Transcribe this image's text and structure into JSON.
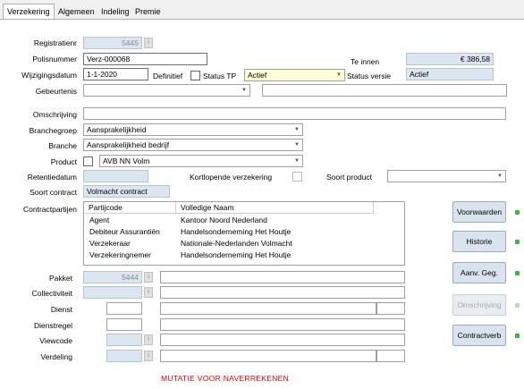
{
  "tabs": [
    "Verzekering",
    "Algemeen",
    "Indeling",
    "Premie"
  ],
  "labels": {
    "registratienr": "Registratienr",
    "polisnummer": "Polisnummer",
    "wijzigingsdatum": "Wijzigingsdatum",
    "definitief": "Definitief",
    "status_tp": "Status TP",
    "status_versie": "Status versie",
    "te_innen": "Te innen",
    "gebeurtenis": "Gebeurtenis",
    "omschrijving": "Omschrijving",
    "branchegroep": "Branchegroep",
    "branche": "Branche",
    "product": "Product",
    "retentiedatum": "Retentiedatum",
    "kortlopende": "Kortlopende verzekering",
    "soort_product": "Soort product",
    "soort_contract": "Soort contract",
    "contractpartijen": "Contractpartijen",
    "pakket": "Pakket",
    "collectiviteit": "Collectiviteit",
    "dienst": "Dienst",
    "dienstregel": "Dienstregel",
    "viewcode": "Viewcode",
    "verdeling": "Verdeling"
  },
  "values": {
    "registratienr": "5445",
    "polisnummer": "Verz-000068",
    "wijzigingsdatum": "1-1-2020",
    "status_tp": "Actief",
    "status_versie": "Actief",
    "te_innen": "€ 386,58",
    "branchegroep": "Aansprakelijkheid",
    "branche": "Aansprakelijkheid bedrijf",
    "product": "AVB NN Volm",
    "soort_contract": "Volmacht contract",
    "pakket": "5444"
  },
  "grid": {
    "headers": [
      "Partijcode",
      "Volledige Naam"
    ],
    "rows": [
      [
        "Agent",
        "Kantoor Noord Nederland"
      ],
      [
        "Debiteur Assurantiën",
        "Handelsonderneming Het Houtje"
      ],
      [
        "Verzekeraar",
        "Nationale-Nederlanden Volmacht"
      ],
      [
        "Verzekeringnemer",
        "Handelsonderneming Het Houtje"
      ]
    ]
  },
  "buttons": {
    "voorwaarden": "Voorwaarden",
    "historie": "Historie",
    "aanv_geg": "Aanv. Geg.",
    "omschrijving": "Omschrijving",
    "contractverb": "Contractverb"
  },
  "info_icon": "i",
  "status_message": "MUTATIE VOOR NAVERREKENEN"
}
